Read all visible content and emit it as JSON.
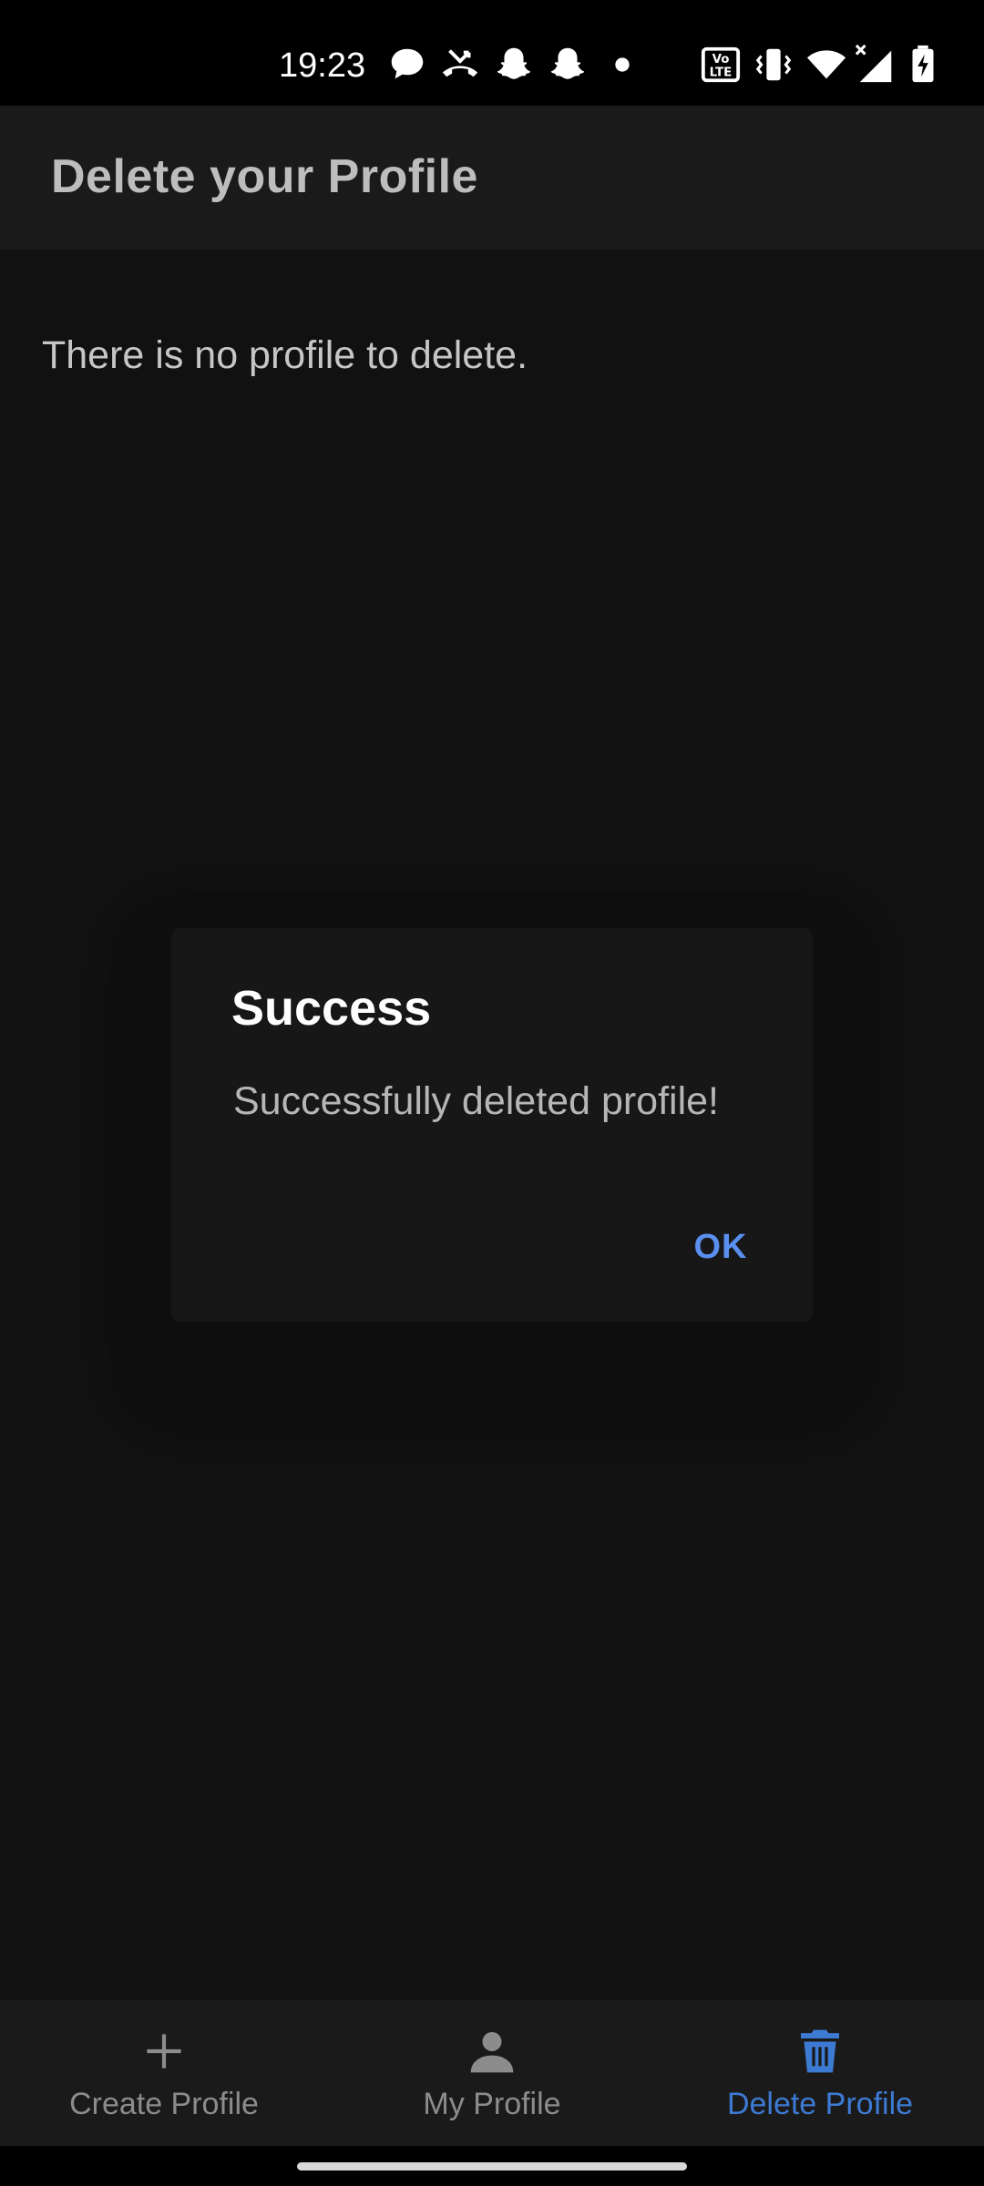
{
  "status_bar": {
    "time": "19:23",
    "icons": [
      "chat-bubble-icon",
      "missed-call-icon",
      "snapchat-icon",
      "snapchat-icon",
      "dot-icon",
      "volte-icon",
      "vibrate-icon",
      "wifi-icon",
      "signal-icon",
      "battery-charging-icon"
    ]
  },
  "app_bar": {
    "title": "Delete your Profile"
  },
  "body": {
    "message": "There is no profile to delete."
  },
  "dialog": {
    "title": "Success",
    "message": "Successfully deleted profile!",
    "ok_label": "OK"
  },
  "bottom_nav": {
    "items": [
      {
        "label": "Create Profile",
        "icon": "plus-icon",
        "active": false
      },
      {
        "label": "My Profile",
        "icon": "person-icon",
        "active": false
      },
      {
        "label": "Delete Profile",
        "icon": "trash-icon",
        "active": true
      }
    ]
  },
  "colors": {
    "background": "#111111",
    "app_bar": "#1a1a1a",
    "dialog": "#171717",
    "accent": "#3d7ad4",
    "dialog_button": "#5a8ff0"
  }
}
